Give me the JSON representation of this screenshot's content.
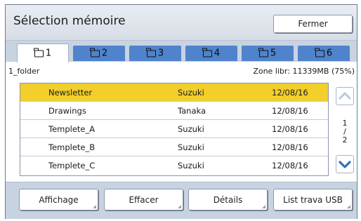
{
  "window": {
    "title": "Sélection mémoire",
    "close_label": "Fermer"
  },
  "tabs": [
    {
      "label": "1",
      "icon": "folder-icon",
      "active": true
    },
    {
      "label": "2",
      "icon": "folder-icon",
      "active": false
    },
    {
      "label": "3",
      "icon": "folder-icon",
      "active": false
    },
    {
      "label": "4",
      "icon": "folder-icon",
      "active": false
    },
    {
      "label": "5",
      "icon": "folder-icon",
      "active": false
    },
    {
      "label": "6",
      "icon": "folder-icon",
      "active": false
    }
  ],
  "info": {
    "folder_name": "1_folder",
    "free_space": "Zone libr: 11339MB (75%)"
  },
  "files": [
    {
      "name": "Newsletter",
      "owner": "Suzuki",
      "date": "12/08/16",
      "selected": true
    },
    {
      "name": "Drawings",
      "owner": "Tanaka",
      "date": "12/08/16",
      "selected": false
    },
    {
      "name": "Templete_A",
      "owner": "Suzuki",
      "date": "12/08/16",
      "selected": false
    },
    {
      "name": "Templete_B",
      "owner": "Suzuki",
      "date": "12/08/16",
      "selected": false
    },
    {
      "name": "Templete_C",
      "owner": "Suzuki",
      "date": "12/08/16",
      "selected": false
    }
  ],
  "pager": {
    "current": "1",
    "separator": "/",
    "total": "2",
    "up_icon": "chevron-up-icon",
    "down_icon": "chevron-down-icon"
  },
  "footer": {
    "display_label": "Affichage",
    "delete_label": "Effacer",
    "details_label": "Détails",
    "usb_label": "List trava USB"
  },
  "colors": {
    "tab_blue": "#4f83cc",
    "selected_row": "#f2cf2b",
    "scroll_down_arrow": "#2f6fc4",
    "scroll_up_arrow_disabled": "#b9cce6"
  }
}
